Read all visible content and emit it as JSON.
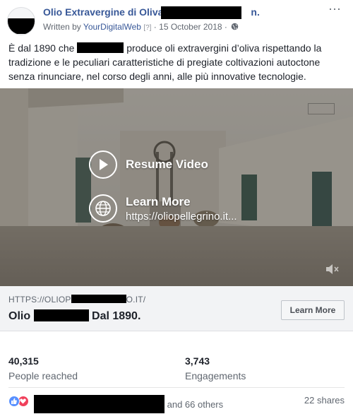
{
  "post": {
    "page_name": "Olio Extravergine di Oliva",
    "page_name_tail": "n.",
    "written_by_prefix": "Written by",
    "author": "YourDigitalWeb",
    "help_mark": "[?]",
    "separator": "·",
    "date": "15 October 2018",
    "more_icon": "···",
    "text_before": "È dal 1890 che",
    "text_after": "produce oli extravergini d’oliva rispettando la tradizione e le peculiari caratteristiche di pregiate coltivazioni autoctone senza rinunciare, nel corso degli anni, alle più innovative tecnologie."
  },
  "video": {
    "resume_label": "Resume Video",
    "learn_label": "Learn More",
    "learn_url": "https://oliopellegrino.it...",
    "icons": [
      "play-icon",
      "globe-icon",
      "mute-icon"
    ]
  },
  "link": {
    "domain_prefix": "HTTPS://OLIOP",
    "domain_suffix": "O.IT/",
    "headline_prefix": "Olio",
    "headline_suffix": "Dal 1890.",
    "button_label": "Learn More"
  },
  "stats": {
    "reached_value": "40,315",
    "reached_label": "People reached",
    "engagements_value": "3,743",
    "engagements_label": "Engagements"
  },
  "reactions": {
    "names_suffix": "and 66 others",
    "shares": "22 shares",
    "colors": {
      "like": "#5890ff",
      "love": "#f0405b"
    }
  },
  "colors": {
    "link_blue": "#385898",
    "text": "#1d2129",
    "muted": "#606770"
  }
}
